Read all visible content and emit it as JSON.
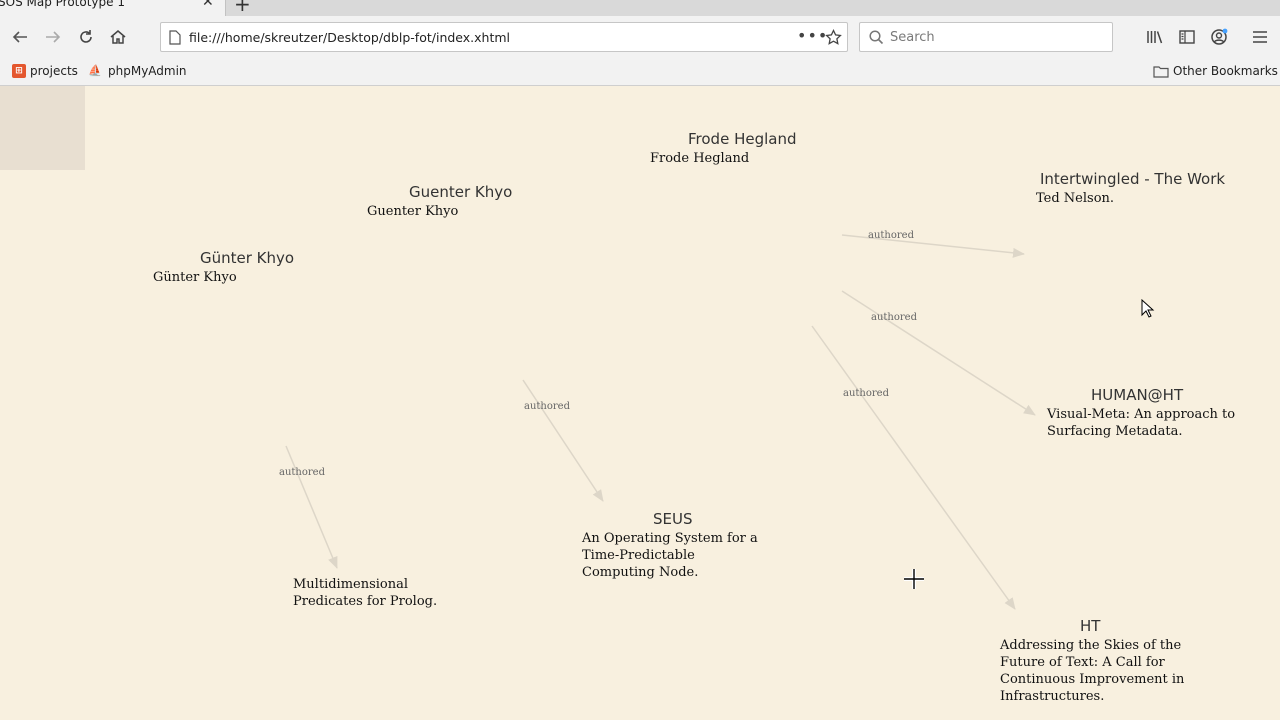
{
  "browser": {
    "tab_title": "SOS Map Prototype 1",
    "url": "file:///home/skreutzer/Desktop/dblp-fot/index.xhtml",
    "search_placeholder": "Search",
    "bookmarks": [
      "projects",
      "phpMyAdmin"
    ],
    "other_bookmarks": "Other Bookmarks"
  },
  "map": {
    "nodes": [
      {
        "title": "Frode Hegland",
        "subtitle": "Frode Hegland"
      },
      {
        "title": "Guenter Khyo",
        "subtitle": "Guenter Khyo"
      },
      {
        "title": "Günter Khyo",
        "subtitle": "Günter Khyo"
      },
      {
        "title": "Intertwingled - The Work",
        "subtitle": "Ted Nelson."
      },
      {
        "title": "HUMAN@HT",
        "subtitle": "Visual-Meta: An approach to Surfacing Metadata."
      },
      {
        "title": "SEUS",
        "subtitle": "An Operating System for a Time-Predictable Computing Node."
      },
      {
        "title": "",
        "subtitle": "Multidimensional Predicates for Prolog."
      },
      {
        "title": "HT",
        "subtitle": "Addressing the Skies of the Future of Text: A Call for Continuous Improvement in Infrastructures."
      }
    ],
    "edge_label": "authored",
    "edge_color": "#ddd6c8"
  }
}
